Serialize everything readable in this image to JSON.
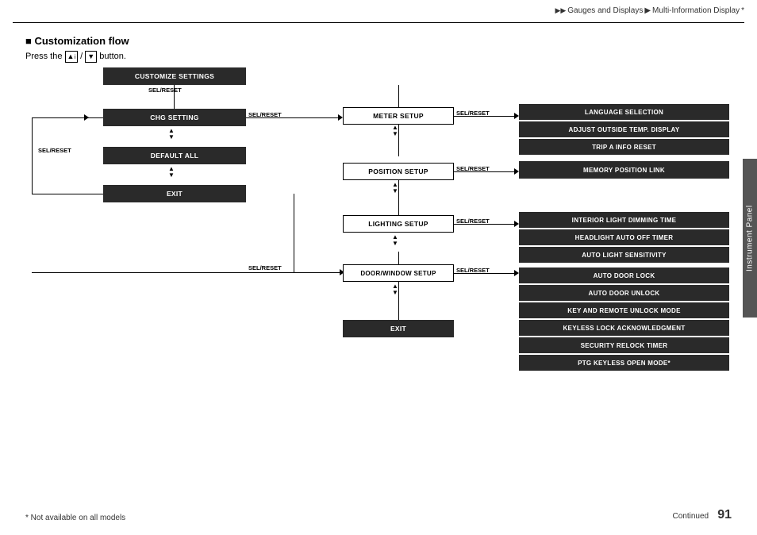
{
  "header": {
    "breadcrumb1": "Gauges and Displays",
    "breadcrumb2": "Multi-Information Display",
    "asterisk": "*"
  },
  "section": {
    "title": "■ Customization flow",
    "instruction_prefix": "Press the",
    "instruction_suffix": "button."
  },
  "sidebar": {
    "label": "Instrument Panel"
  },
  "footer": {
    "note": "* Not available on all models",
    "continued": "Continued",
    "page": "91"
  },
  "boxes": {
    "customize_settings": "CUSTOMIZE SETTINGS",
    "chg_setting": "CHG SETTING",
    "default_all": "DEFAULT ALL",
    "exit_left": "EXIT",
    "meter_setup": "METER SETUP",
    "position_setup": "POSITION SETUP",
    "lighting_setup": "LIGHTING SETUP",
    "door_window_setup": "DOOR/WINDOW SETUP",
    "exit_bottom": "EXIT",
    "language_selection": "LANGUAGE SELECTION",
    "adjust_outside_temp": "ADJUST OUTSIDE TEMP. DISPLAY",
    "trip_a_info_reset": "TRIP A INFO RESET",
    "memory_position_link": "MEMORY POSITION LINK",
    "interior_light_dimming": "INTERIOR LIGHT DIMMING TIME",
    "headlight_auto_off": "HEADLIGHT AUTO OFF TIMER",
    "auto_light_sensitivity": "AUTO LIGHT SENSITIVITY",
    "auto_door_lock": "AUTO DOOR LOCK",
    "auto_door_unlock": "AUTO DOOR UNLOCK",
    "key_remote_unlock": "KEY AND REMOTE UNLOCK MODE",
    "keyless_lock_ack": "KEYLESS LOCK ACKNOWLEDGMENT",
    "security_relock": "SECURITY RELOCK TIMER",
    "ptg_keyless": "PTG KEYLESS OPEN MODE*"
  },
  "labels": {
    "sel_reset": "SEL/RESET"
  }
}
